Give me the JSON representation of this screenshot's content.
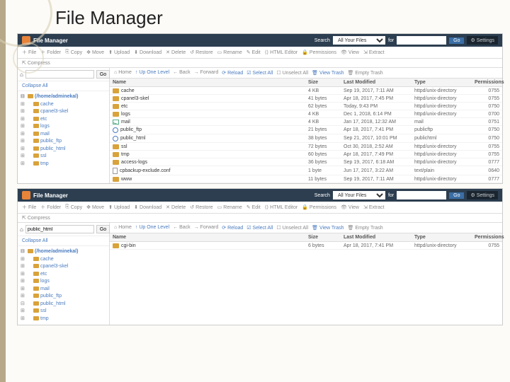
{
  "slide_title": "File Manager",
  "header": {
    "app": "File Manager",
    "search_label": "Search",
    "search_scope": "All Your Files",
    "for_label": "for",
    "go": "Go",
    "settings": "Settings"
  },
  "toolbar": {
    "file": "File",
    "folder": "Folder",
    "copy": "Copy",
    "move": "Move",
    "upload": "Upload",
    "download": "Download",
    "delete": "Delete",
    "restore": "Restore",
    "rename": "Rename",
    "edit": "Edit",
    "html_editor": "HTML Editor",
    "permissions": "Permissions",
    "view": "View",
    "extract": "Extract",
    "compress": "Compress"
  },
  "mainbar": {
    "home": "Home",
    "up": "Up One Level",
    "back": "Back",
    "forward": "Forward",
    "reload": "Reload",
    "select_all": "Select All",
    "unselect_all": "Unselect All",
    "view_trash": "View Trash",
    "empty_trash": "Empty Trash"
  },
  "columns": {
    "name": "Name",
    "size": "Size",
    "mod": "Last Modified",
    "type": "Type",
    "perm": "Permissions"
  },
  "panel1": {
    "path": "",
    "go_btn": "Go",
    "collapse": "Collapse All",
    "root": "(/home/adminekal)",
    "tree": [
      "cache",
      "cpanel3-skel",
      "etc",
      "logs",
      "mail",
      "public_ftp",
      "public_html",
      "ssl",
      "tmp"
    ],
    "rows": [
      {
        "icon": "folder",
        "name": "cache",
        "size": "4 KB",
        "mod": "Sep 19, 2017, 7:11 AM",
        "type": "httpd/unix-directory",
        "perm": "0755"
      },
      {
        "icon": "folder",
        "name": "cpanel3-skel",
        "size": "41 bytes",
        "mod": "Apr 18, 2017, 7:45 PM",
        "type": "httpd/unix-directory",
        "perm": "0755"
      },
      {
        "icon": "folder",
        "name": "etc",
        "size": "62 bytes",
        "mod": "Today, 9:43 PM",
        "type": "httpd/unix-directory",
        "perm": "0750"
      },
      {
        "icon": "folder",
        "name": "logs",
        "size": "4 KB",
        "mod": "Dec 1, 2018, 6:14 PM",
        "type": "httpd/unix-directory",
        "perm": "0700"
      },
      {
        "icon": "mail",
        "name": "mail",
        "size": "4 KB",
        "mod": "Jan 17, 2018, 12:32 AM",
        "type": "mail",
        "perm": "0751"
      },
      {
        "icon": "globe",
        "name": "public_ftp",
        "size": "21 bytes",
        "mod": "Apr 18, 2017, 7:41 PM",
        "type": "publicftp",
        "perm": "0750"
      },
      {
        "icon": "globe",
        "name": "public_html",
        "size": "38 bytes",
        "mod": "Sep 21, 2017, 10:01 PM",
        "type": "publichtml",
        "perm": "0750"
      },
      {
        "icon": "folder",
        "name": "ssl",
        "size": "72 bytes",
        "mod": "Oct 30, 2018, 2:52 AM",
        "type": "httpd/unix-directory",
        "perm": "0755"
      },
      {
        "icon": "folder",
        "name": "tmp",
        "size": "60 bytes",
        "mod": "Apr 18, 2017, 7:49 PM",
        "type": "httpd/unix-directory",
        "perm": "0755"
      },
      {
        "icon": "folder",
        "name": "access-logs",
        "size": "36 bytes",
        "mod": "Sep 19, 2017, 6:18 AM",
        "type": "httpd/unix-directory",
        "perm": "0777"
      },
      {
        "icon": "file",
        "name": "cpbackup-exclude.conf",
        "size": "1 byte",
        "mod": "Jun 17, 2017, 3:22 AM",
        "type": "text/plain",
        "perm": "0640"
      },
      {
        "icon": "folder",
        "name": "www",
        "size": "11 bytes",
        "mod": "Sep 19, 2017, 7:11 AM",
        "type": "httpd/unix-directory",
        "perm": "0777"
      }
    ]
  },
  "panel2": {
    "path": "public_html",
    "go_btn": "Go",
    "collapse": "Collapse All",
    "root": "(/home/adminekal)",
    "tree": [
      "cache",
      "cpanel3-skel",
      "etc",
      "logs",
      "mail",
      "public_ftp",
      "public_html",
      "ssl",
      "tmp"
    ],
    "rows": [
      {
        "icon": "folder",
        "name": "cgi-bin",
        "size": "6 bytes",
        "mod": "Apr 18, 2017, 7:41 PM",
        "type": "httpd/unix-directory",
        "perm": "0755"
      }
    ]
  }
}
